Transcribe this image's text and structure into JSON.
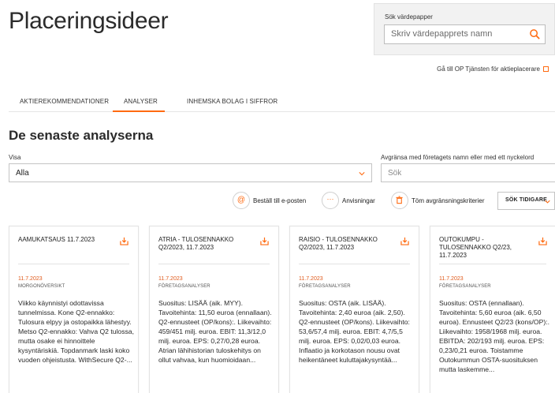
{
  "header": {
    "title": "Placeringsideer"
  },
  "search": {
    "label": "Sök värdepapper",
    "placeholder": "Skriv värdepapprets namn",
    "icon": "search-icon"
  },
  "op_link": {
    "label": "Gå till OP Tjänsten för aktieplacerare",
    "icon": "external-link-icon"
  },
  "tabs": [
    {
      "label": "AKTIEREKOMMENDATIONER",
      "active": false
    },
    {
      "label": "ANALYSER",
      "active": true
    },
    {
      "label": "INHEMSKA BOLAG I SIFFROR",
      "active": false
    }
  ],
  "section": {
    "title": "De senaste analyserna"
  },
  "filters": {
    "visa_label": "Visa",
    "visa_value": "Alla",
    "limit_label": "Avgränsa med företagets namn eller med ett nyckelord",
    "limit_placeholder": "Sök"
  },
  "actions": {
    "email_label": "Beställ till e-posten",
    "notes_label": "Anvisningar",
    "clear_label": "Töm avgränsningskriterier",
    "earlier_label": "SÖK TIDIGARE"
  },
  "colors": {
    "accent": "#ff6a10",
    "date": "#e0591a"
  },
  "cards": [
    {
      "title": "AAMUKATSAUS 11.7.2023",
      "date": "11.7.2023",
      "category": "MORGONÖVERSIKT",
      "text": "Viikko käynnistyi odottavissa tunnelmissa. Kone Q2-ennakko: Tulosura elpyy ja ostopaikka lähestyy. Metso Q2-ennakko: Vahva Q2 tulossa, mutta osake ei hinnoittele kysyntäriskiä. Topdanmark laski koko vuoden ohjeistusta. WithSecure Q2-..."
    },
    {
      "title": "ATRIA - TULOSENNAKKO Q2/2023, 11.7.2023",
      "date": "11.7.2023",
      "category": "FÖRETAGSANALYSER",
      "text": "Suositus: LISÄÄ (aik. MYY). Tavoitehinta: 11,50 euroa (ennallaan). Q2-ennusteet (OP/kons):. Liikevaihto: 459/451 milj. euroa. EBIT: 11,3/12,0 milj. euroa. EPS: 0,27/0,28 euroa. Atrian lähihistorian tuloskehitys on ollut vahvaa, kun huomioidaan..."
    },
    {
      "title": "RAISIO - TULOSENNAKKO Q2/2023, 11.7.2023",
      "date": "11.7.2023",
      "category": "FÖRETAGSANALYSER",
      "text": "Suositus: OSTA (aik. LISÄÄ). Tavoitehinta: 2,40 euroa (aik. 2,50). Q2-ennusteet (OP/kons). Liikevaihto: 53,6/57,4 milj. euroa. EBIT: 4,7/5,5 milj. euroa. EPS: 0,02/0,03 euroa. Inflaatio ja korkotason nousu ovat heikentäneet kuluttajakysyntää..."
    },
    {
      "title": "OUTOKUMPU - TULOSENNAKKO Q2/23, 11.7.2023",
      "date": "11.7.2023",
      "category": "FÖRETAGSANALYSER",
      "text": "Suositus: OSTA (ennallaan). Tavoitehinta: 5,60 euroa (aik. 6,50 euroa). Ennusteet Q2/23 (kons/OP):. Liikevaihto: 1958/1968 milj. euroa. EBITDA: 202/193 milj. euroa. EPS: 0,23/0,21 euroa. Toistamme Outokummun OSTA-suosituksen mutta laskemme..."
    }
  ]
}
